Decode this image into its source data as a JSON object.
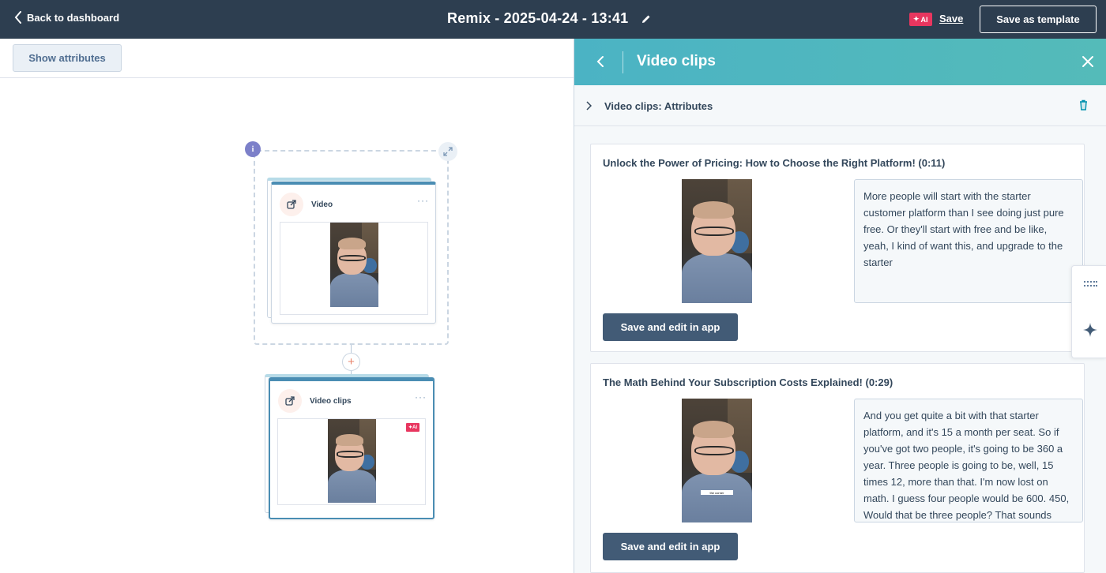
{
  "topbar": {
    "back_label": "Back to dashboard",
    "title": "Remix - 2025-04-24 - 13:41",
    "ai_badge": "AI",
    "save_label": "Save",
    "save_template_label": "Save as template"
  },
  "toolbar": {
    "show_attributes_label": "Show attributes"
  },
  "canvas": {
    "info_badge": "i",
    "nodes": [
      {
        "label": "Video"
      },
      {
        "label": "Video clips",
        "ai_badge": "AI"
      }
    ],
    "add_symbol": "+"
  },
  "panel": {
    "title": "Video clips",
    "attributes_label": "Video clips: Attributes",
    "clips": [
      {
        "title": "Unlock the Power of Pricing: How to Choose the Right Platform! (0:11)",
        "transcript": "More people will start with the starter customer platform than I see doing just pure free. Or they'll start with free and be like, yeah, I kind of want this, and upgrade to the starter",
        "button_label": "Save and edit in app"
      },
      {
        "title": "The Math Behind Your Subscription Costs Explained! (0:29)",
        "transcript": "And you get quite a bit with that starter platform, and it's 15 a month per seat. So if you've got two people, it's going to be 360 a year. Three people is going to be, well, 15 times 12, more than that. I'm now lost on math. I guess four people would be 600. 450, Would that be three people? That sounds",
        "caption": "the corner",
        "button_label": "Save and edit in app"
      }
    ]
  },
  "colors": {
    "topbar_bg": "#2d3e50",
    "panel_header": "#4bb3c4",
    "accent_pink": "#e8365f",
    "button_dark": "#425b76"
  }
}
